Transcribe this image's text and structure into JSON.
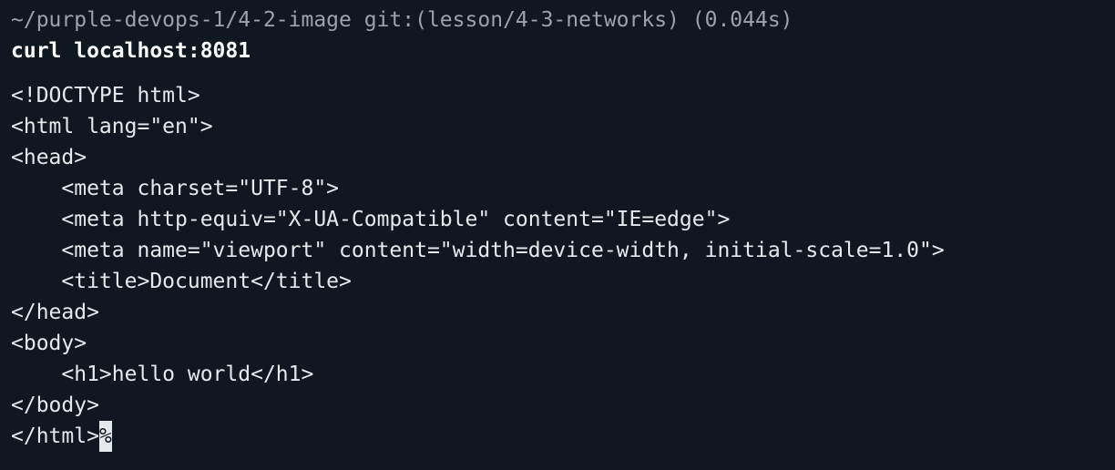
{
  "prompt": {
    "text": "~/purple-devops-1/4-2-image git:(lesson/4-3-networks) (0.044s)"
  },
  "command": {
    "text": "curl localhost:8081"
  },
  "output": {
    "lines": [
      "<!DOCTYPE html>",
      "<html lang=\"en\">",
      "<head>",
      "    <meta charset=\"UTF-8\">",
      "    <meta http-equiv=\"X-UA-Compatible\" content=\"IE=edge\">",
      "    <meta name=\"viewport\" content=\"width=device-width, initial-scale=1.0\">",
      "    <title>Document</title>",
      "</head>",
      "<body>",
      "    <h1>hello world</h1>",
      "</body>",
      "</html>"
    ],
    "trailing_marker": "%"
  },
  "colors": {
    "background": "#0f1820",
    "foreground": "#e6e9ec",
    "prompt": "#9aa3ab"
  }
}
